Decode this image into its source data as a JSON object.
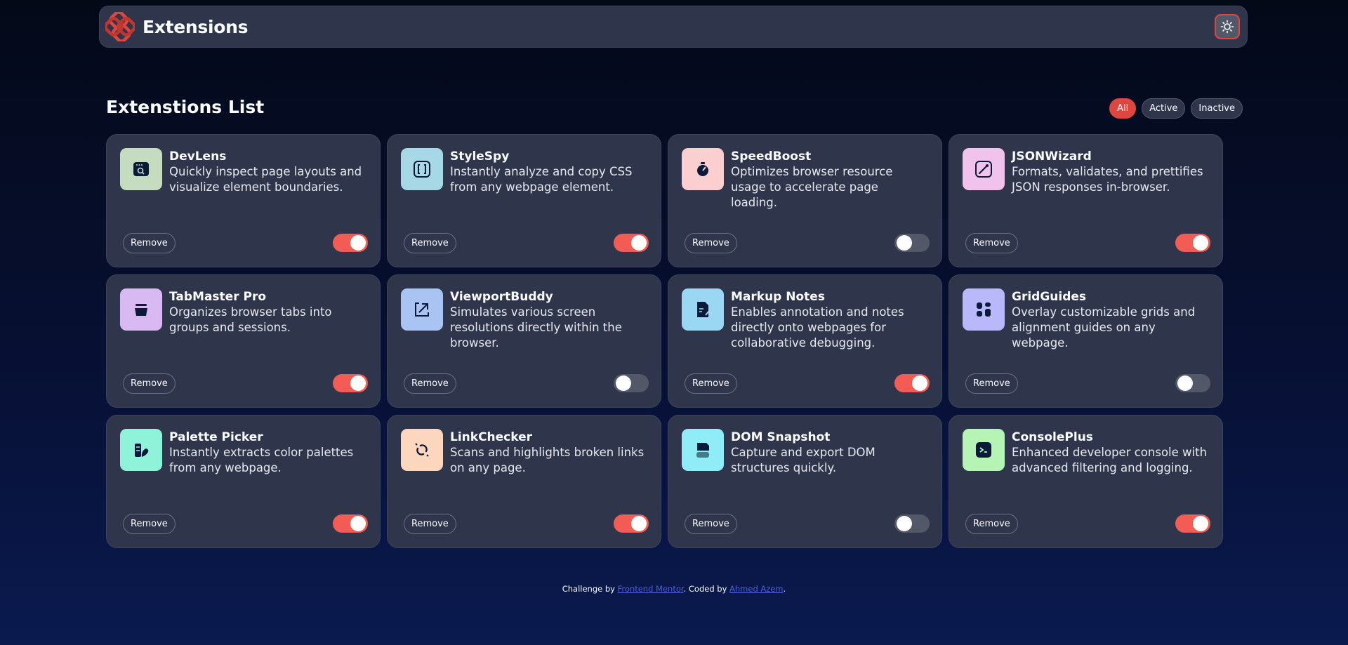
{
  "header": {
    "brand": "Extensions",
    "logo_icon": "extensions-logo-icon",
    "theme_icon": "sun-icon",
    "accent": "#de473f"
  },
  "list": {
    "title": "Extenstions List",
    "filters": [
      {
        "label": "All",
        "active": true
      },
      {
        "label": "Active",
        "active": false
      },
      {
        "label": "Inactive",
        "active": false
      }
    ]
  },
  "cards": [
    {
      "name": "DevLens",
      "desc": "Quickly inspect page layouts and visualize element boundaries.",
      "icon": "browser-search-icon",
      "icon_bg": "#c6dcc0",
      "on": true,
      "remove": "Remove"
    },
    {
      "name": "StyleSpy",
      "desc": "Instantly analyze and copy CSS from any webpage element.",
      "icon": "brackets-icon",
      "icon_bg": "#a6d8e5",
      "on": true,
      "remove": "Remove"
    },
    {
      "name": "SpeedBoost",
      "desc": "Optimizes browser resource usage to accelerate page loading.",
      "icon": "stopwatch-icon",
      "icon_bg": "#fbcfcf",
      "on": false,
      "remove": "Remove"
    },
    {
      "name": "JSONWizard",
      "desc": "Formats, validates, and prettifies JSON responses in-browser.",
      "icon": "magic-wand-icon",
      "icon_bg": "#f1c2ec",
      "on": true,
      "remove": "Remove"
    },
    {
      "name": "TabMaster Pro",
      "desc": "Organizes browser tabs into groups and sessions.",
      "icon": "stacked-tabs-icon",
      "icon_bg": "#d8b9f1",
      "on": true,
      "remove": "Remove"
    },
    {
      "name": "ViewportBuddy",
      "desc": "Simulates various screen resolutions directly within the browser.",
      "icon": "resize-arrow-icon",
      "icon_bg": "#a9c4f2",
      "on": false,
      "remove": "Remove"
    },
    {
      "name": "Markup Notes",
      "desc": "Enables annotation and notes directly onto webpages for collaborative debugging.",
      "icon": "note-pen-icon",
      "icon_bg": "#9ad7f2",
      "on": true,
      "remove": "Remove"
    },
    {
      "name": "GridGuides",
      "desc": "Overlay customizable grids and alignment guides on any webpage.",
      "icon": "grid-icon",
      "icon_bg": "#b8b8fb",
      "on": false,
      "remove": "Remove"
    },
    {
      "name": "Palette Picker",
      "desc": "Instantly extracts color palettes from any webpage.",
      "icon": "palette-icon",
      "icon_bg": "#8ef3d8",
      "on": true,
      "remove": "Remove"
    },
    {
      "name": "LinkChecker",
      "desc": "Scans and highlights broken links on any page.",
      "icon": "broken-link-icon",
      "icon_bg": "#fdd7bd",
      "on": true,
      "remove": "Remove"
    },
    {
      "name": "DOM Snapshot",
      "desc": "Capture and export DOM structures quickly.",
      "icon": "snapshot-icon",
      "icon_bg": "#90ecf6",
      "on": false,
      "remove": "Remove"
    },
    {
      "name": "ConsolePlus",
      "desc": "Enhanced developer console with advanced filtering and logging.",
      "icon": "terminal-icon",
      "icon_bg": "#b6f4b6",
      "on": true,
      "remove": "Remove"
    }
  ],
  "footer": {
    "prefix": "Challenge by ",
    "link1": "Frontend Mentor",
    "middle": ". Coded by ",
    "link2": "Ahmed Azem",
    "suffix": "."
  }
}
